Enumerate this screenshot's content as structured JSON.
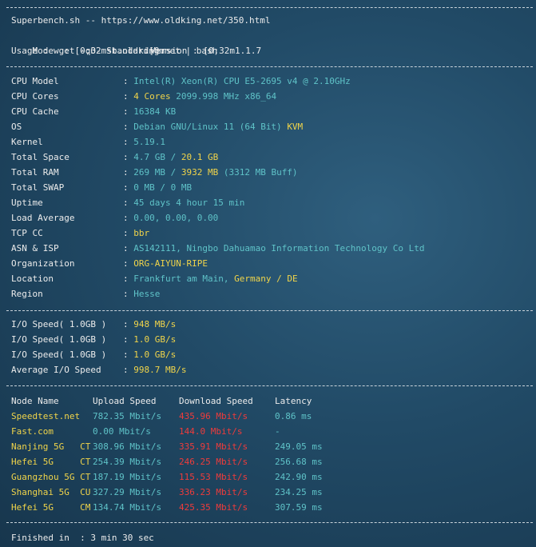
{
  "header": {
    "line1": "Superbench.sh -- https://www.oldking.net/350.html",
    "mode_label": "Mode  : [0;32mStandard[0m",
    "version_label": "Version : [0;32m1.1.7",
    "usage": "Usage : wget -qO- sb.oldking.net | bash"
  },
  "sysinfo": [
    {
      "label": "CPU Model",
      "parts": [
        {
          "t": "Intel(R) Xeon(R) CPU E5-2695 v4 @ 2.10GHz",
          "c": "cyan"
        }
      ]
    },
    {
      "label": "CPU Cores",
      "parts": [
        {
          "t": "4 Cores",
          "c": "yellow"
        },
        {
          "t": " 2099.998 MHz x86_64",
          "c": "cyan"
        }
      ]
    },
    {
      "label": "CPU Cache",
      "parts": [
        {
          "t": "16384 KB",
          "c": "cyan"
        }
      ]
    },
    {
      "label": "OS",
      "parts": [
        {
          "t": "Debian GNU/Linux 11 (64 Bit) ",
          "c": "cyan"
        },
        {
          "t": "KVM",
          "c": "yellow"
        }
      ]
    },
    {
      "label": "Kernel",
      "parts": [
        {
          "t": "5.19.1",
          "c": "cyan"
        }
      ]
    },
    {
      "label": "Total Space",
      "parts": [
        {
          "t": "4.7 GB / ",
          "c": "cyan"
        },
        {
          "t": "20.1 GB",
          "c": "yellow"
        }
      ]
    },
    {
      "label": "Total RAM",
      "parts": [
        {
          "t": "269 MB / ",
          "c": "cyan"
        },
        {
          "t": "3932 MB",
          "c": "yellow"
        },
        {
          "t": " (3312 MB Buff)",
          "c": "cyan"
        }
      ]
    },
    {
      "label": "Total SWAP",
      "parts": [
        {
          "t": "0 MB / 0 MB",
          "c": "cyan"
        }
      ]
    },
    {
      "label": "Uptime",
      "parts": [
        {
          "t": "45 days 4 hour 15 min",
          "c": "cyan"
        }
      ]
    },
    {
      "label": "Load Average",
      "parts": [
        {
          "t": "0.00, 0.00, 0.00",
          "c": "cyan"
        }
      ]
    },
    {
      "label": "TCP CC",
      "parts": [
        {
          "t": "bbr",
          "c": "yellow"
        }
      ]
    },
    {
      "label": "ASN & ISP",
      "parts": [
        {
          "t": "AS142111, Ningbo Dahuamao Information Technology Co Ltd",
          "c": "cyan"
        }
      ]
    },
    {
      "label": "Organization",
      "parts": [
        {
          "t": "ORG-AIYUN-RIPE",
          "c": "yellow"
        }
      ]
    },
    {
      "label": "Location",
      "parts": [
        {
          "t": "Frankfurt am Main, ",
          "c": "cyan"
        },
        {
          "t": "Germany / DE",
          "c": "yellow"
        }
      ]
    },
    {
      "label": "Region",
      "parts": [
        {
          "t": "Hesse",
          "c": "cyan"
        }
      ]
    }
  ],
  "colon": ": ",
  "io": [
    {
      "label": "I/O Speed( 1.0GB )",
      "value": "948 MB/s"
    },
    {
      "label": "I/O Speed( 1.0GB )",
      "value": "1.0 GB/s"
    },
    {
      "label": "I/O Speed( 1.0GB )",
      "value": "1.0 GB/s"
    },
    {
      "label": "Average I/O Speed",
      "value": "998.7 MB/s"
    }
  ],
  "speed": {
    "headers": [
      "Node Name",
      "Upload Speed",
      "Download Speed",
      "Latency"
    ],
    "rows": [
      {
        "node": "Speedtest.net",
        "upload": "782.35 Mbit/s",
        "download": "435.96 Mbit/s",
        "latency": "0.86 ms"
      },
      {
        "node": "Fast.com",
        "upload": "0.00 Mbit/s",
        "download": "144.0 Mbit/s",
        "latency": "-"
      },
      {
        "node": "Nanjing 5G   CT",
        "upload": "308.96 Mbit/s",
        "download": "335.91 Mbit/s",
        "latency": "249.05 ms"
      },
      {
        "node": "Hefei 5G     CT",
        "upload": "254.39 Mbit/s",
        "download": "246.25 Mbit/s",
        "latency": "256.68 ms"
      },
      {
        "node": "Guangzhou 5G CT",
        "upload": "187.19 Mbit/s",
        "download": "115.53 Mbit/s",
        "latency": "242.90 ms"
      },
      {
        "node": "Shanghai 5G  CU",
        "upload": "327.29 Mbit/s",
        "download": "336.23 Mbit/s",
        "latency": "234.25 ms"
      },
      {
        "node": "Hefei 5G     CM",
        "upload": "134.74 Mbit/s",
        "download": "425.35 Mbit/s",
        "latency": "307.59 ms"
      }
    ]
  },
  "footer": {
    "finished": "Finished in  : 3 min 30 sec"
  },
  "colors": {
    "cyan": "#5fc3c8",
    "yellow": "#f0d44a",
    "red": "#ef3b3b",
    "white": "#ececec"
  }
}
